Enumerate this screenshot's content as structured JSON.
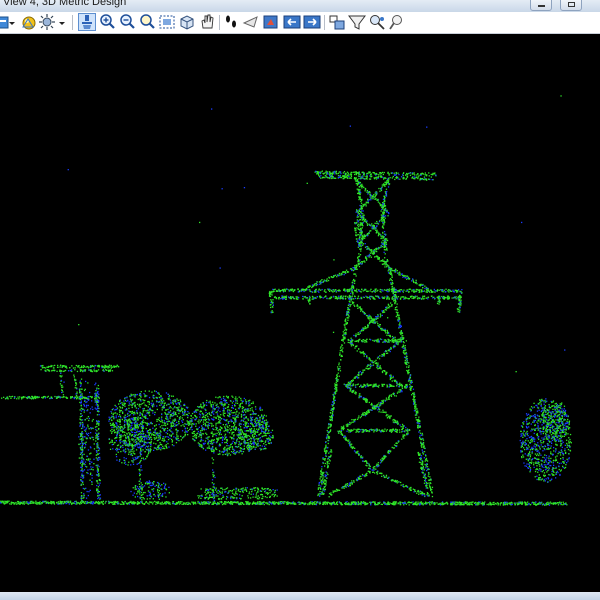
{
  "window": {
    "title": "View 4, 3D Metric Design"
  },
  "toolbar": {
    "tools": [
      {
        "name": "view-attributes-icon"
      },
      {
        "name": "dropdown-arrow-icon"
      },
      {
        "name": "display-style-icon"
      },
      {
        "name": "lighting-icon"
      },
      {
        "name": "dropdown-arrow-icon"
      },
      {
        "name": "update-view-icon",
        "active": true
      },
      {
        "name": "zoom-in-icon"
      },
      {
        "name": "zoom-out-icon"
      },
      {
        "name": "window-area-icon"
      },
      {
        "name": "fit-view-icon"
      },
      {
        "name": "rotate-view-icon"
      },
      {
        "name": "pan-view-icon"
      },
      {
        "name": "walk-icon"
      },
      {
        "name": "view-previous-icon"
      },
      {
        "name": "view-next-icon"
      },
      {
        "name": "camera-icon"
      },
      {
        "name": "clip-volume-icon"
      },
      {
        "name": "clip-mask-icon"
      },
      {
        "name": "view-display-icon"
      }
    ]
  },
  "viewport": {
    "background": "#000000",
    "colors": {
      "green": "#2fe628",
      "blue": "#1a3cff"
    }
  }
}
